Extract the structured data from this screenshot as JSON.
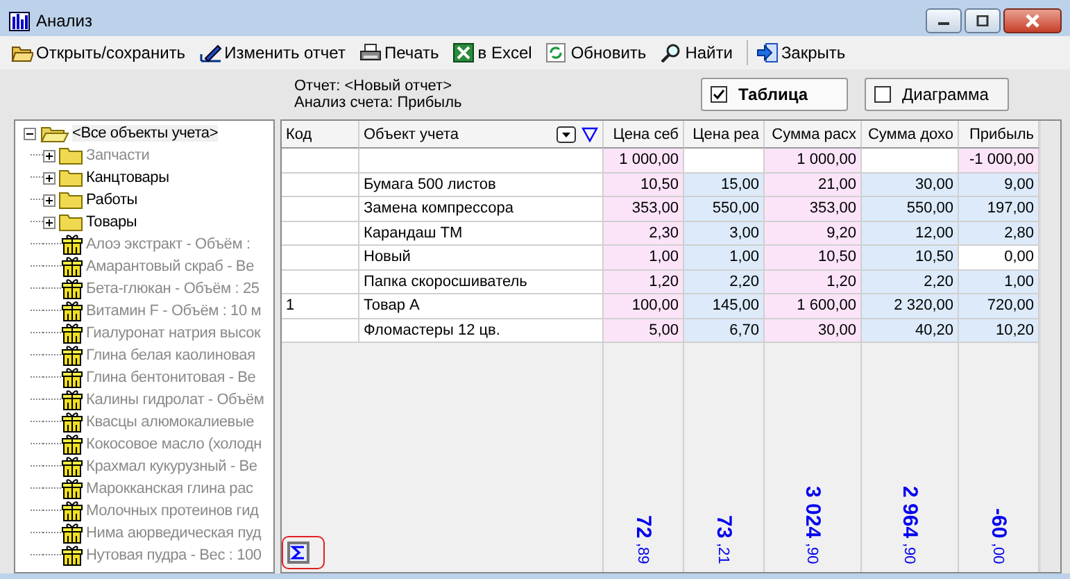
{
  "window": {
    "title": "Анализ"
  },
  "toolbar": [
    {
      "label": "Открыть/сохранить"
    },
    {
      "label": "Изменить отчет"
    },
    {
      "label": "Печать"
    },
    {
      "label": "в Excel"
    },
    {
      "label": "Обновить"
    },
    {
      "label": "Найти"
    },
    {
      "label": "Закрыть"
    }
  ],
  "report": {
    "name": "Отчет:  <Новый отчет>",
    "account": "Анализ счета:  Прибыль"
  },
  "view_toggles": [
    {
      "label": "Таблица",
      "checked": true
    },
    {
      "label": "Диаграмма",
      "checked": false
    }
  ],
  "tree": {
    "label": "<Все объекты учета>",
    "expanded": true,
    "disabled": false,
    "children": [
      {
        "label": "Запчасти",
        "kind": "folder",
        "expanded": false,
        "disabled": true
      },
      {
        "label": "Канцтовары",
        "kind": "folder",
        "expanded": false,
        "disabled": false
      },
      {
        "label": "Работы",
        "kind": "folder",
        "expanded": false,
        "disabled": false
      },
      {
        "label": "Товары",
        "kind": "folder",
        "expanded": false,
        "disabled": false
      },
      {
        "label": "Алоэ экстракт - Объём :",
        "kind": "item",
        "disabled": true
      },
      {
        "label": "Амарантовый скраб - Ве",
        "kind": "item",
        "disabled": true
      },
      {
        "label": "Бета-глюкан - Объём : 25",
        "kind": "item",
        "disabled": true
      },
      {
        "label": "Витамин F - Объём : 10 м",
        "kind": "item",
        "disabled": true
      },
      {
        "label": "Гиалуронат натрия высок",
        "kind": "item",
        "disabled": true
      },
      {
        "label": "Глина белая каолиновая",
        "kind": "item",
        "disabled": true
      },
      {
        "label": "Глина бентонитовая - Ве",
        "kind": "item",
        "disabled": true
      },
      {
        "label": "Калины гидролат - Объём",
        "kind": "item",
        "disabled": true
      },
      {
        "label": "Квасцы алюмокалиевые",
        "kind": "item",
        "disabled": true
      },
      {
        "label": "Кокосовое масло (холодн",
        "kind": "item",
        "disabled": true
      },
      {
        "label": "Крахмал кукурузный - Ве",
        "kind": "item",
        "disabled": true
      },
      {
        "label": "Марокканская глина рас",
        "kind": "item",
        "disabled": true
      },
      {
        "label": "Молочных протеинов гид",
        "kind": "item",
        "disabled": true
      },
      {
        "label": "Нима аюрведическая пуд",
        "kind": "item",
        "disabled": true
      },
      {
        "label": "Нутовая пудра - Вес : 100",
        "kind": "item",
        "disabled": true
      }
    ]
  },
  "table": {
    "columns": [
      "Код",
      "Объект учета",
      "Цена себ",
      "Цена реа",
      "Сумма расх",
      "Сумма дохо",
      "Прибыль"
    ],
    "rows": [
      {
        "code": "",
        "object": "",
        "values": [
          {
            "text": "1 000,00",
            "kind": "cost"
          },
          {
            "kind": "plain"
          },
          {
            "text": "1 000,00",
            "kind": "cost"
          },
          {
            "kind": "plain"
          },
          {
            "text": "-1 000,00",
            "kind": "cost"
          }
        ]
      },
      {
        "code": "",
        "object": "Бумага 500 листов",
        "values": [
          {
            "text": "10,50",
            "kind": "cost"
          },
          {
            "text": "15,00",
            "kind": "income"
          },
          {
            "text": "21,00",
            "kind": "cost"
          },
          {
            "text": "30,00",
            "kind": "income"
          },
          {
            "text": "9,00",
            "kind": "income"
          }
        ]
      },
      {
        "code": "",
        "object": "Замена компрессора",
        "values": [
          {
            "text": "353,00",
            "kind": "cost"
          },
          {
            "text": "550,00",
            "kind": "income"
          },
          {
            "text": "353,00",
            "kind": "cost"
          },
          {
            "text": "550,00",
            "kind": "income"
          },
          {
            "text": "197,00",
            "kind": "income"
          }
        ]
      },
      {
        "code": "",
        "object": "Карандаш ТМ",
        "values": [
          {
            "text": "2,30",
            "kind": "cost"
          },
          {
            "text": "3,00",
            "kind": "income"
          },
          {
            "text": "9,20",
            "kind": "cost"
          },
          {
            "text": "12,00",
            "kind": "income"
          },
          {
            "text": "2,80",
            "kind": "income"
          }
        ]
      },
      {
        "code": "",
        "object": "Новый",
        "values": [
          {
            "text": "1,00",
            "kind": "cost"
          },
          {
            "text": "1,00",
            "kind": "income"
          },
          {
            "text": "10,50",
            "kind": "cost"
          },
          {
            "text": "10,50",
            "kind": "income"
          },
          {
            "text": "0,00",
            "kind": "plain"
          }
        ]
      },
      {
        "code": "",
        "object": "Папка скоросшиватель",
        "values": [
          {
            "text": "1,20",
            "kind": "cost"
          },
          {
            "text": "2,20",
            "kind": "income"
          },
          {
            "text": "1,20",
            "kind": "cost"
          },
          {
            "text": "2,20",
            "kind": "income"
          },
          {
            "text": "1,00",
            "kind": "income"
          }
        ]
      },
      {
        "code": "1",
        "object": "Товар А",
        "values": [
          {
            "text": "100,00",
            "kind": "cost"
          },
          {
            "text": "145,00",
            "kind": "income"
          },
          {
            "text": "1 600,00",
            "kind": "cost"
          },
          {
            "text": "2 320,00",
            "kind": "income"
          },
          {
            "text": "720,00",
            "kind": "income"
          }
        ]
      },
      {
        "code": "",
        "object": "Фломастеры 12 цв.",
        "values": [
          {
            "text": "5,00",
            "kind": "cost"
          },
          {
            "text": "6,70",
            "kind": "income"
          },
          {
            "text": "30,00",
            "kind": "cost"
          },
          {
            "text": "40,20",
            "kind": "income"
          },
          {
            "text": "10,20",
            "kind": "income"
          }
        ]
      }
    ],
    "totals": [
      {
        "integer": "72",
        "fraction": ",89"
      },
      {
        "integer": "73",
        "fraction": ",21"
      },
      {
        "integer": "3 024",
        "fraction": ",90"
      },
      {
        "integer": "2 964",
        "fraction": ",90"
      },
      {
        "integer": "-60",
        "fraction": ",00"
      }
    ]
  }
}
